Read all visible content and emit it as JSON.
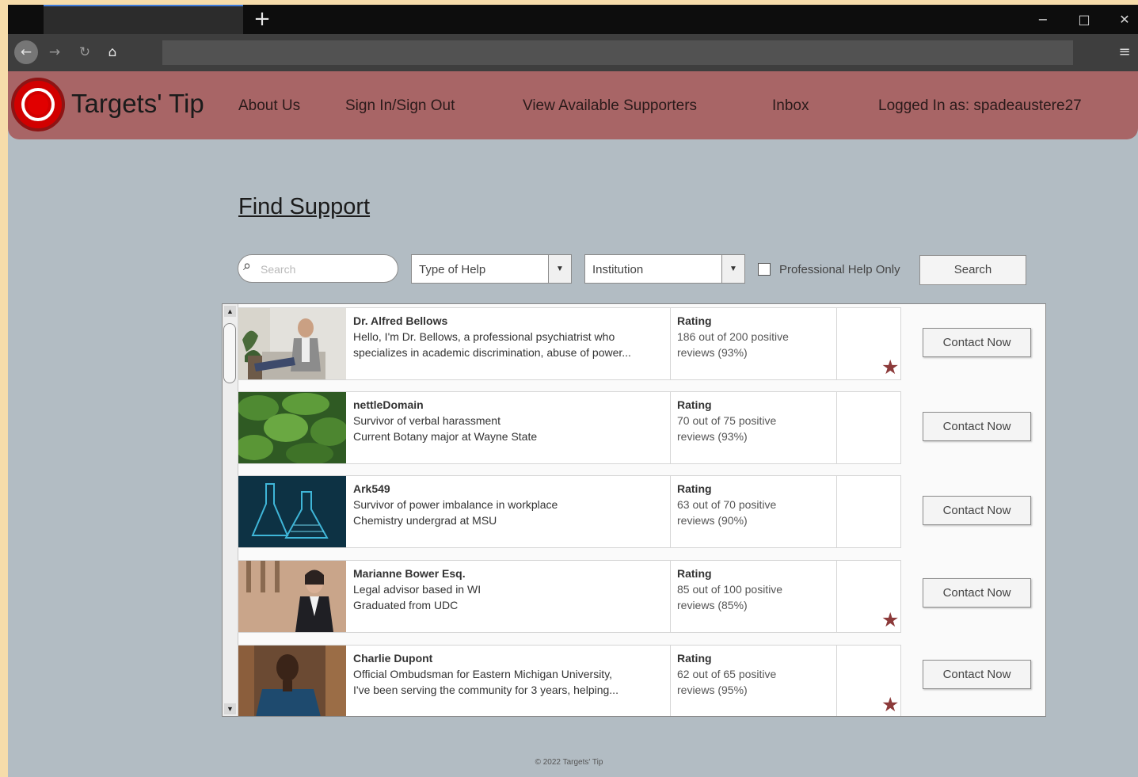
{
  "header": {
    "brand": "Targets' Tip",
    "nav": [
      "About Us",
      "Sign In/Sign Out",
      "View Available Supporters",
      "Inbox",
      "Logged In as: spadeaustere27"
    ]
  },
  "page": {
    "title": "Find Support"
  },
  "filters": {
    "search_placeholder": "Search",
    "type_of_help": "Type of Help",
    "institution": "Institution",
    "professional_only_label": "Professional Help Only",
    "professional_only_checked": false,
    "search_button": "Search"
  },
  "results": [
    {
      "name": "Dr. Alfred Bellows",
      "line1": "Hello, I'm Dr. Bellows, a professional psychiatrist who",
      "line2": "specializes in academic discrimination, abuse of power...",
      "rating_title": "Rating",
      "rating_line1": "186 out of 200 positive",
      "rating_line2": "reviews (93%)",
      "starred": true,
      "button": "Contact Now",
      "photo": "man-in-suit-seated"
    },
    {
      "name": "nettleDomain",
      "line1": "Survivor of verbal harassment",
      "line2": "Current Botany major at Wayne State",
      "rating_title": "Rating",
      "rating_line1": "70 out of 75 positive",
      "rating_line2": "reviews (93%)",
      "starred": false,
      "button": "Contact Now",
      "photo": "nettle-leaves"
    },
    {
      "name": "Ark549",
      "line1": "Survivor of power imbalance in workplace",
      "line2": "Chemistry undergrad at MSU",
      "rating_title": "Rating",
      "rating_line1": "63 out of 70 positive",
      "rating_line2": "reviews (90%)",
      "starred": false,
      "button": "Contact Now",
      "photo": "lab-flasks"
    },
    {
      "name": "Marianne Bower Esq.",
      "line1": "Legal advisor based in WI",
      "line2": "Graduated from UDC",
      "rating_title": "Rating",
      "rating_line1": "85 out of 100 positive",
      "rating_line2": "reviews (85%)",
      "starred": true,
      "button": "Contact Now",
      "photo": "woman-in-blazer"
    },
    {
      "name": "Charlie Dupont",
      "line1": "Official Ombudsman for Eastern Michigan University,",
      "line2": "I've been serving the community for 3 years, helping...",
      "rating_title": "Rating",
      "rating_line1": "62 out of 65 positive",
      "rating_line2": "reviews (95%)",
      "starred": true,
      "button": "Contact Now",
      "photo": "man-in-blue-suit"
    }
  ],
  "footer": "© 2022 Targets' Tip",
  "colors": {
    "header_bg": "#a86566",
    "page_bg": "#b2bcc3",
    "star": "#8c3a3a",
    "logo_red": "#d10000"
  }
}
